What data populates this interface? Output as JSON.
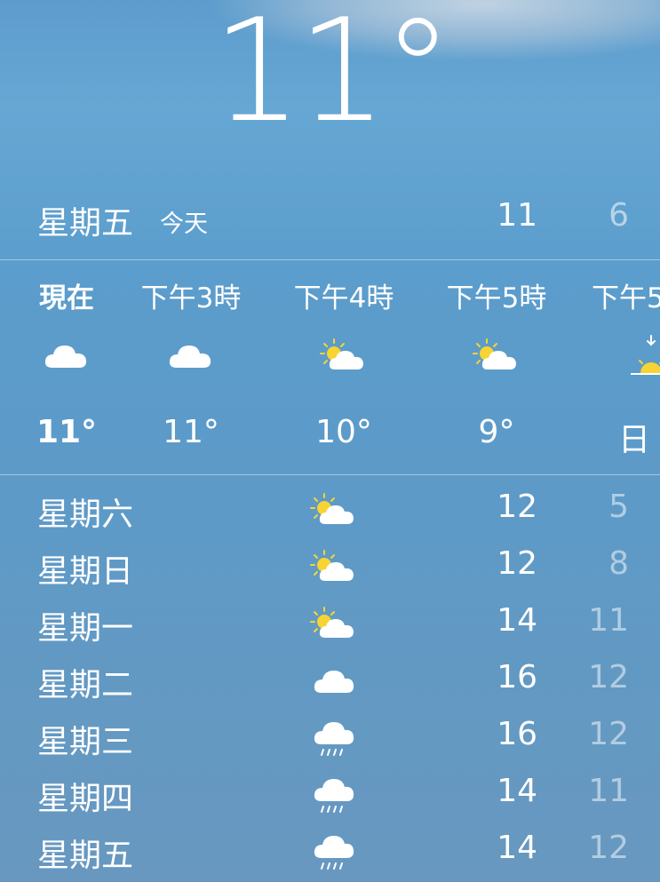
{
  "current": {
    "temperature": "11°"
  },
  "today": {
    "day": "星期五",
    "label": "今天",
    "high": "11",
    "low": "6"
  },
  "hourly": [
    {
      "time": "現在",
      "icon": "cloud-icon",
      "temp": "11°"
    },
    {
      "time": "下午3時",
      "icon": "cloud-icon",
      "temp": "11°"
    },
    {
      "time": "下午4時",
      "icon": "partly-cloudy-icon",
      "temp": "10°"
    },
    {
      "time": "下午5時",
      "icon": "partly-cloudy-icon",
      "temp": "9°"
    },
    {
      "time": "下午5",
      "icon": "sunset-icon",
      "temp": "日"
    }
  ],
  "daily": [
    {
      "day": "星期六",
      "icon": "partly-cloudy-icon",
      "high": "12",
      "low": "5"
    },
    {
      "day": "星期日",
      "icon": "partly-cloudy-icon",
      "high": "12",
      "low": "8"
    },
    {
      "day": "星期一",
      "icon": "partly-cloudy-icon",
      "high": "14",
      "low": "11"
    },
    {
      "day": "星期二",
      "icon": "cloud-icon",
      "high": "16",
      "low": "12"
    },
    {
      "day": "星期三",
      "icon": "rain-icon",
      "high": "16",
      "low": "12"
    },
    {
      "day": "星期四",
      "icon": "rain-icon",
      "high": "14",
      "low": "11"
    },
    {
      "day": "星期五",
      "icon": "rain-icon",
      "high": "14",
      "low": "12"
    }
  ],
  "colors": {
    "sun": "#f7d433",
    "cloud": "#ffffff",
    "rain": "#ffffff"
  }
}
